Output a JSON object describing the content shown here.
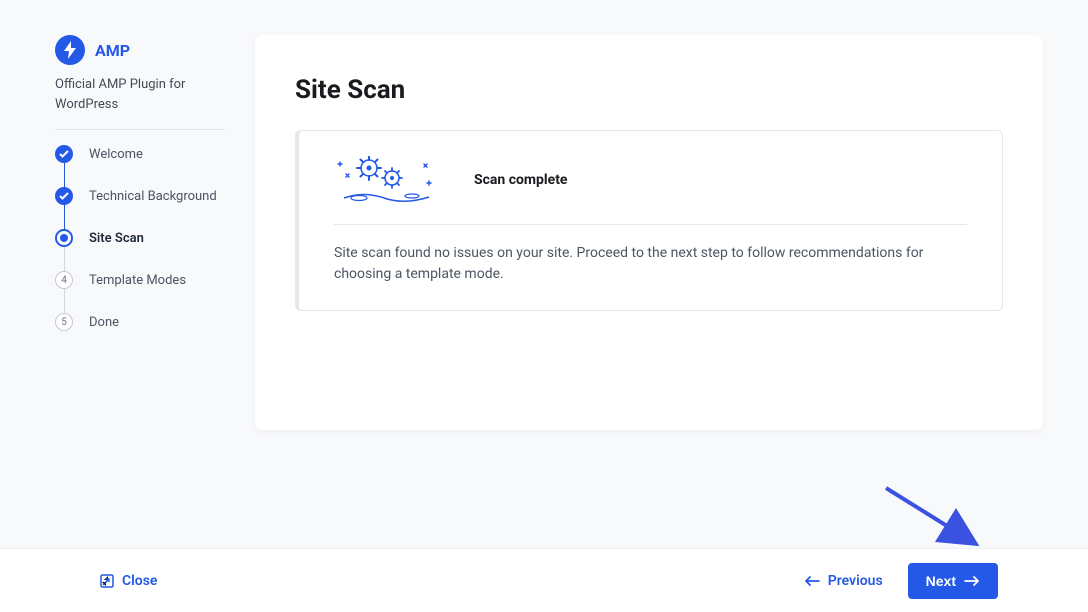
{
  "sidebar": {
    "logo_text": "AMP",
    "subtitle": "Official AMP Plugin for WordPress",
    "steps": [
      {
        "label": "Welcome",
        "state": "done"
      },
      {
        "label": "Technical Background",
        "state": "done"
      },
      {
        "label": "Site Scan",
        "state": "current"
      },
      {
        "label": "Template Modes",
        "state": "pending",
        "number": "4"
      },
      {
        "label": "Done",
        "state": "pending",
        "number": "5"
      }
    ]
  },
  "main": {
    "title": "Site Scan",
    "scan_title": "Scan complete",
    "scan_body": "Site scan found no issues on your site. Proceed to the next step to follow recommendations for choosing a template mode."
  },
  "footer": {
    "close": "Close",
    "previous": "Previous",
    "next": "Next"
  }
}
